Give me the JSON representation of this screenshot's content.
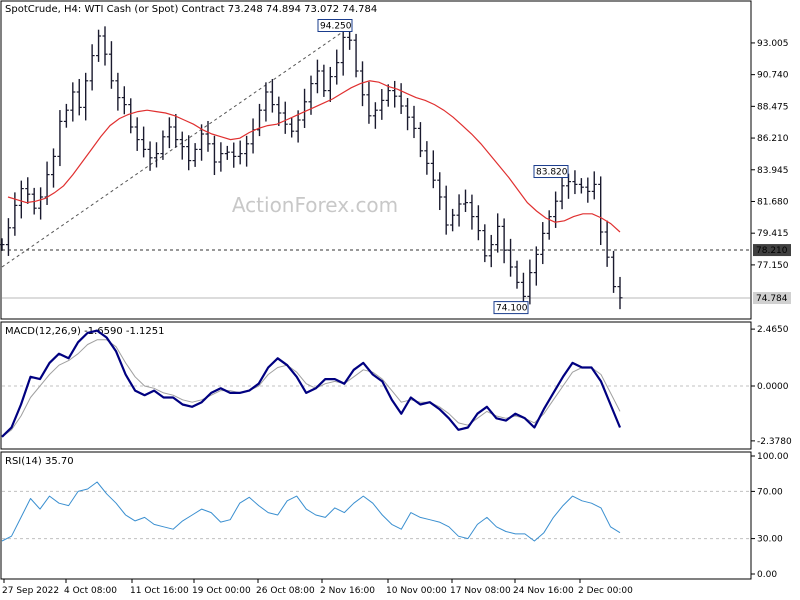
{
  "header": {
    "symbol": "SpotCrude, H4:",
    "description": "WTI Cash (or Spot) Contract",
    "ohlc": "73.248 74.894 73.072 74.784"
  },
  "watermark": "ActionForex.com",
  "colors": {
    "bars": "#1a1a2e",
    "sma": "#e03030",
    "macd": "#000080",
    "signal": "#a0a0a0",
    "rsi": "#3a8fd0",
    "label_box": "#1a3c8c",
    "hline": "#333333"
  },
  "chart_data": [
    {
      "type": "line",
      "title": "",
      "series": [
        {
          "values": [
            78.6,
            79.8,
            81.4,
            82.6,
            82.2,
            81.2,
            82.0,
            83.6,
            84.9,
            87.4,
            88.2,
            89.5,
            88.4,
            90.3,
            92.1,
            93.5,
            92.2,
            90.3,
            89.1,
            88.6,
            87.0,
            86.1,
            85.4,
            84.8,
            85.1,
            86.3,
            87.0,
            86.1,
            85.6,
            84.6,
            85.4,
            86.5,
            85.8,
            84.5,
            85.1,
            85.2,
            84.9,
            85.1,
            85.8,
            86.8,
            88.2,
            89.5,
            88.6,
            88.0,
            87.2,
            86.7,
            87.5,
            88.8,
            90.1,
            91.0,
            89.6,
            90.6,
            91.6,
            93.4,
            93.2,
            91.0,
            89.3,
            87.8,
            88.2,
            88.9,
            89.6,
            89.2,
            88.5,
            87.7,
            86.9,
            85.3,
            84.4,
            83.2,
            82.0,
            80.0,
            80.7,
            81.5,
            81.6,
            80.6,
            79.6,
            77.8,
            78.6,
            79.9,
            78.2,
            77.0,
            75.9,
            74.9,
            76.6,
            77.9,
            79.4,
            80.6,
            81.7,
            82.8,
            83.1,
            82.9,
            82.7,
            82.4,
            82.9,
            79.5,
            77.7,
            75.6,
            74.8
          ]
        },
        {
          "values": [
            82.0,
            81.8,
            81.6,
            81.7,
            81.9,
            82.3,
            82.8,
            83.6,
            84.5,
            85.4,
            86.3,
            87.1,
            87.6,
            87.9,
            88.1,
            88.2,
            88.1,
            88.0,
            87.8,
            87.5,
            87.2,
            86.8,
            86.5,
            86.3,
            86.1,
            86.2,
            86.6,
            86.9,
            87.1,
            87.2,
            87.5,
            87.8,
            88.1,
            88.4,
            88.7,
            89.0,
            89.4,
            89.8,
            90.1,
            90.3,
            90.2,
            89.9,
            89.7,
            89.4,
            89.1,
            88.9,
            88.6,
            88.2,
            87.7,
            87.1,
            86.5,
            85.8,
            85.0,
            84.2,
            83.4,
            82.5,
            81.6,
            81.0,
            80.5,
            80.2,
            80.3,
            80.6,
            80.8,
            80.8,
            80.5,
            80.1,
            79.5
          ]
        }
      ],
      "y_axis_ticks": [
        "93.005",
        "90.740",
        "88.475",
        "86.210",
        "83.945",
        "81.680",
        "79.415",
        "77.150"
      ],
      "ylim": [
        73.5,
        95.5
      ],
      "annotations": [
        {
          "text": "94.250",
          "value": 94.25
        },
        {
          "text": "83.820",
          "value": 83.82
        },
        {
          "text": "74.100",
          "value": 74.1
        }
      ],
      "price_lines": [
        {
          "text": "78.210",
          "value": 78.21,
          "style": "dashed",
          "highlight": true
        },
        {
          "text": "74.784",
          "value": 74.784,
          "style": "solid",
          "highlight": false
        }
      ],
      "grid": false
    },
    {
      "type": "line",
      "title": "MACD(12,26,9) -1.6590 -1.1251",
      "series": [
        {
          "values": [
            -2.2,
            -1.8,
            -0.8,
            0.4,
            0.3,
            1.0,
            1.4,
            1.2,
            1.9,
            2.3,
            2.4,
            2.1,
            1.5,
            0.5,
            -0.2,
            -0.4,
            -0.2,
            -0.5,
            -0.5,
            -0.8,
            -0.9,
            -0.7,
            -0.3,
            -0.1,
            -0.3,
            -0.3,
            -0.2,
            0.1,
            0.8,
            1.2,
            0.9,
            0.4,
            -0.3,
            -0.1,
            0.3,
            0.3,
            0.1,
            0.7,
            1.0,
            0.5,
            0.2,
            -0.6,
            -1.2,
            -0.5,
            -0.8,
            -0.7,
            -1.0,
            -1.4,
            -1.9,
            -1.8,
            -1.2,
            -0.9,
            -1.4,
            -1.5,
            -1.2,
            -1.4,
            -1.8,
            -1.0,
            -0.3,
            0.4,
            1.0,
            0.8,
            0.8,
            0.2,
            -0.8,
            -1.8
          ]
        },
        {
          "values": [
            -2.2,
            -1.9,
            -1.3,
            -0.5,
            0.0,
            0.5,
            0.9,
            1.1,
            1.4,
            1.8,
            2.0,
            2.0,
            1.7,
            1.0,
            0.4,
            0.0,
            -0.1,
            -0.3,
            -0.4,
            -0.6,
            -0.7,
            -0.6,
            -0.4,
            -0.2,
            -0.2,
            -0.3,
            -0.2,
            0.0,
            0.5,
            0.8,
            0.9,
            0.6,
            0.1,
            -0.1,
            0.1,
            0.2,
            0.1,
            0.4,
            0.7,
            0.6,
            0.3,
            -0.2,
            -0.7,
            -0.6,
            -0.7,
            -0.7,
            -0.9,
            -1.2,
            -1.6,
            -1.7,
            -1.4,
            -1.1,
            -1.3,
            -1.4,
            -1.3,
            -1.4,
            -1.6,
            -1.2,
            -0.6,
            0.0,
            0.6,
            0.8,
            0.8,
            0.5,
            -0.3,
            -1.1
          ]
        }
      ],
      "y_axis_ticks": [
        "2.4650",
        "0.0000",
        "-2.3780"
      ],
      "ylim": [
        -2.6,
        2.6
      ]
    },
    {
      "type": "line",
      "title": "RSI(14) 35.70",
      "series": [
        {
          "values": [
            28,
            32,
            48,
            64,
            55,
            66,
            60,
            58,
            70,
            72,
            78,
            68,
            60,
            50,
            45,
            48,
            42,
            40,
            38,
            45,
            50,
            55,
            52,
            44,
            46,
            60,
            65,
            58,
            52,
            50,
            62,
            66,
            55,
            50,
            48,
            56,
            52,
            60,
            66,
            60,
            50,
            42,
            38,
            52,
            48,
            46,
            44,
            40,
            32,
            30,
            42,
            48,
            40,
            36,
            34,
            34,
            28,
            35,
            48,
            58,
            66,
            62,
            60,
            56,
            40,
            35
          ]
        }
      ],
      "y_axis_ticks": [
        "100.00",
        "70.00",
        "30.00",
        "0.00"
      ],
      "ylim": [
        0,
        100
      ]
    }
  ],
  "x_axis_ticks": [
    "27 Sep 2022",
    "4 Oct 08:00",
    "11 Oct 16:00",
    "19 Oct 00:00",
    "26 Oct 08:00",
    "2 Nov 16:00",
    "10 Nov 00:00",
    "17 Nov 08:00",
    "24 Nov 16:00",
    "2 Dec 00:00"
  ]
}
